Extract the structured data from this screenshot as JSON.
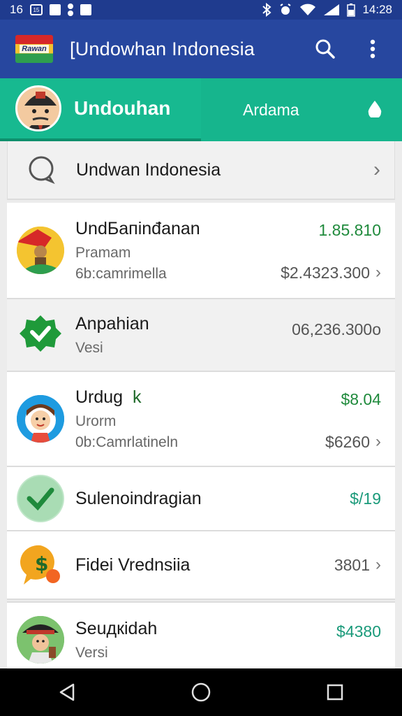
{
  "status_bar": {
    "left_time": "16",
    "badge": "15",
    "time": "14:28"
  },
  "app_bar": {
    "logo_text": "Rawan",
    "title": "[Undowhan Indonesia"
  },
  "tabs": {
    "active_label": "Undouhan",
    "second_label": "Ardama"
  },
  "header_row": {
    "label": "Undwan Indonesia"
  },
  "items": [
    {
      "title": "UndБaпinđanan",
      "sub1": "Pramam",
      "sub2": "6b:camrimella",
      "amount_top": "1.85.810",
      "amount_bottom": "$2.4323.300"
    },
    {
      "title": "Anpahian",
      "sub1": "Vesi",
      "amount": "06,236.300o"
    },
    {
      "title": "Urdug",
      "tag": "k",
      "sub1": "Urorm",
      "sub2": "0b:Camrlatineln",
      "amount_top": "$8.04",
      "amount_bottom": "$6260"
    },
    {
      "title": "Sulenoindragian",
      "amount": "$/19"
    },
    {
      "title": "Fidei Vrednsiia",
      "amount": "3801"
    },
    {
      "title": "Seuдкidah",
      "sub1": "Versi",
      "amount": "$4380"
    }
  ],
  "colors": {
    "appbar": "#27479f",
    "tabbar": "#16b58d",
    "accent_green": "#1f8a3c"
  }
}
